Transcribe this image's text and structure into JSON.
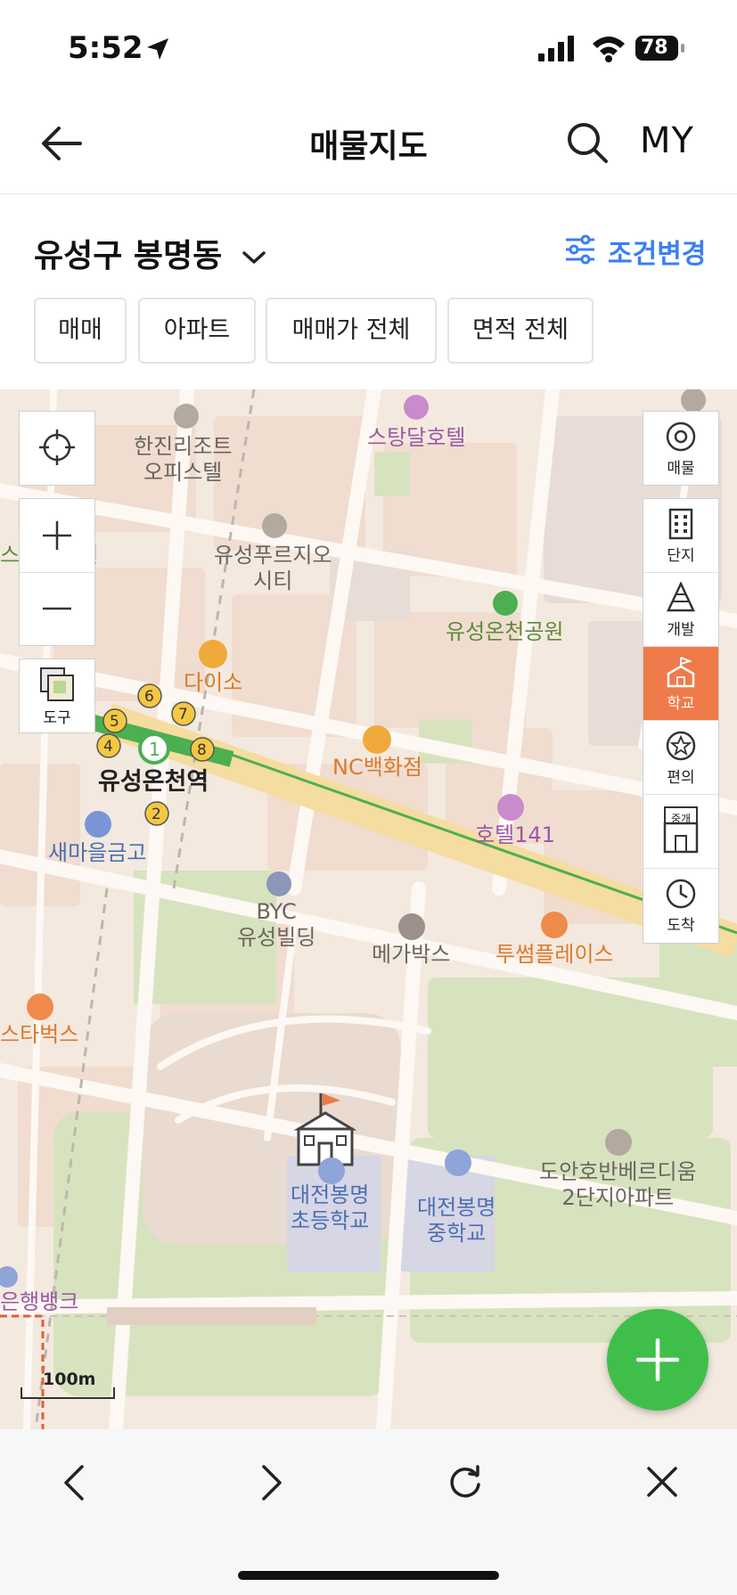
{
  "status": {
    "time": "5:52",
    "battery": "78"
  },
  "header": {
    "title": "매물지도",
    "my_label": "MY"
  },
  "filter": {
    "region": "유성구 봉명동",
    "condition_label": "조건변경",
    "chips": [
      "매매",
      "아파트",
      "매매가 전체",
      "면적 전체"
    ]
  },
  "map": {
    "tools": {
      "tool_label": "도구",
      "scale": "100m"
    },
    "side_buttons": [
      "매물",
      "단지",
      "개발",
      "학교",
      "편의",
      "중개",
      "도착"
    ],
    "labels": {
      "hanjin": "한진리조트\n오피스텔",
      "stadal": "스탕달호텔",
      "yuseong_prugio": "유성푸르지오\n시티",
      "park_left": "스승의공원",
      "yuseongoncheon_park": "유성온천공원",
      "daiso": "다이소",
      "nc": "NC백화점",
      "station": "유성온천역",
      "saemaeul": "새마을금고",
      "hotel141": "호텔141",
      "byc": "BYC\n유성빌딩",
      "megabox": "메가박스",
      "twosome": "투썸플레이스",
      "starbucks": "스타벅스",
      "bongmyeong_elem": "대전봉명\n초등학교",
      "bongmyeong_mid": "대전봉명\n중학교",
      "doan": "도안호반베르디움\n2단지아파트",
      "bank": "은행뱅크"
    },
    "station_exits": [
      "1",
      "2",
      "4",
      "5",
      "6",
      "7",
      "8"
    ]
  },
  "icons": {
    "back": "arrow-left-icon",
    "search": "search-icon",
    "chevron": "chevron-down-icon",
    "filter": "sliders-icon",
    "locate": "crosshair-icon",
    "zoom_in": "plus-icon",
    "zoom_out": "minus-icon",
    "tool": "layers-icon",
    "add": "plus-icon",
    "nav_back": "chevron-left-icon",
    "nav_forward": "chevron-right-icon",
    "reload": "reload-icon",
    "close": "close-icon"
  },
  "colors": {
    "accent_blue": "#3b7ff0",
    "active_orange": "#ef7a4a",
    "fab_green": "#3fbf4a",
    "subway_green": "#4caf50"
  }
}
